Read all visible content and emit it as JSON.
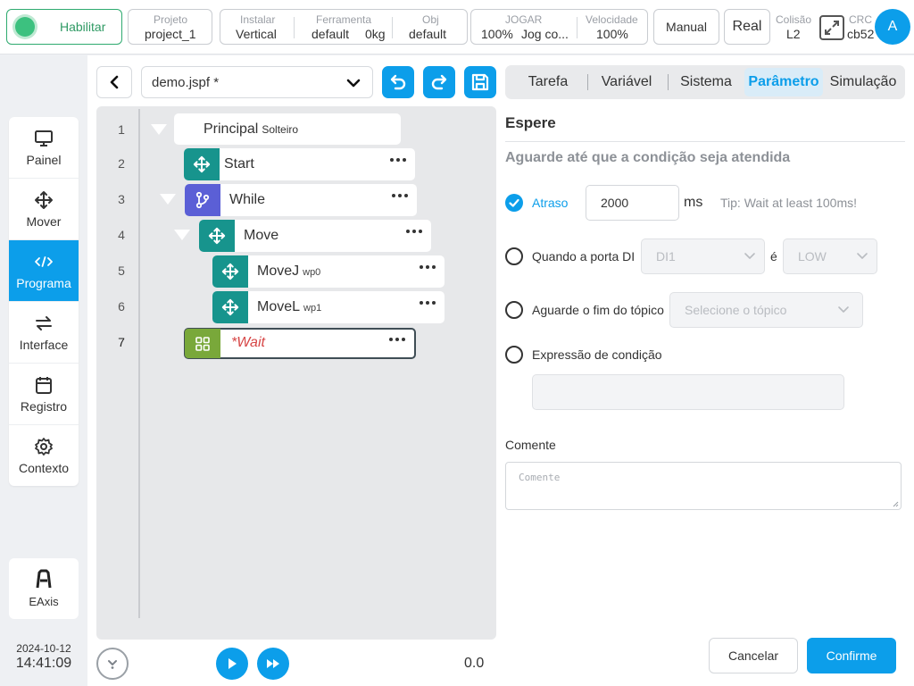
{
  "topbar": {
    "enable_label": "Habilitar",
    "project": {
      "label": "Projeto",
      "value": "project_1"
    },
    "install": {
      "label": "Instalar",
      "value": "Vertical"
    },
    "tool": {
      "label": "Ferramenta",
      "value": "default",
      "weight": "0kg"
    },
    "obj": {
      "label": "Obj",
      "value": "default"
    },
    "jog": {
      "label": "JOGAR",
      "value": "100%",
      "mode": "Jog co..."
    },
    "speed": {
      "label": "Velocidade",
      "value": "100%"
    },
    "manual_label": "Manual",
    "real_label": "Real",
    "collision": {
      "label": "Colisão",
      "value": "L2"
    },
    "crc": {
      "label": "CRC",
      "value": "cb52"
    },
    "avatar_letter": "A",
    "accent": "#0c9eea",
    "enable_color": "#3cc17f"
  },
  "nav": {
    "items": [
      {
        "label": "Painel",
        "icon": "monitor-icon"
      },
      {
        "label": "Mover",
        "icon": "move-arrows-icon"
      },
      {
        "label": "Programa",
        "icon": "code-icon",
        "active": true
      },
      {
        "label": "Interface",
        "icon": "swap-arrows-icon"
      },
      {
        "label": "Registro",
        "icon": "calendar-icon"
      },
      {
        "label": "Contexto",
        "icon": "gear-icon"
      }
    ],
    "eaxis_label": "EAxis",
    "date": "2024-10-12",
    "time": "14:41:09"
  },
  "program": {
    "file_name": "demo.jspf *",
    "lines": [
      "1",
      "2",
      "3",
      "4",
      "5",
      "6",
      "7"
    ],
    "nodes": {
      "main": {
        "label": "Principal",
        "sub": "Solteiro"
      },
      "start": {
        "label": "Start",
        "icon": "move-arrows-icon"
      },
      "while": {
        "label": "While",
        "icon": "branch-icon"
      },
      "move": {
        "label": "Move",
        "icon": "move-arrows-icon"
      },
      "movej": {
        "label": "MoveJ",
        "sub": "wp0",
        "icon": "move-arrows-icon"
      },
      "movel": {
        "label": "MoveL",
        "sub": "wp1",
        "icon": "move-arrows-icon"
      },
      "wait": {
        "label": "*Wait",
        "icon": "grid-icon"
      }
    },
    "speed_value": "0.0",
    "colors": {
      "teal": "#17948d",
      "purple": "#5b5fd6",
      "olive": "#79a83a",
      "wait_text": "#d64545"
    }
  },
  "panel": {
    "tabs": [
      "Tarefa",
      "Variável",
      "Sistema",
      "Parâmetro",
      "Simulação"
    ],
    "active_tab": "Parâmetro",
    "title": "Espere",
    "subtitle": "Aguarde até que a condição seja atendida",
    "delay": {
      "label": "Atraso",
      "value": "2000",
      "unit": "ms",
      "tip": "Tip: Wait at least 100ms!",
      "checked": true
    },
    "di_port": {
      "label": "Quando a porta DI",
      "port": "DI1",
      "is_label": "é",
      "level": "LOW"
    },
    "topic_end": {
      "label": "Aguarde o fim do tópico",
      "placeholder": "Selecione o tópico"
    },
    "condition": {
      "label": "Expressão de condição",
      "value": ""
    },
    "comment": {
      "label": "Comente",
      "placeholder": "Comente"
    },
    "cancel_label": "Cancelar",
    "confirm_label": "Confirme"
  }
}
